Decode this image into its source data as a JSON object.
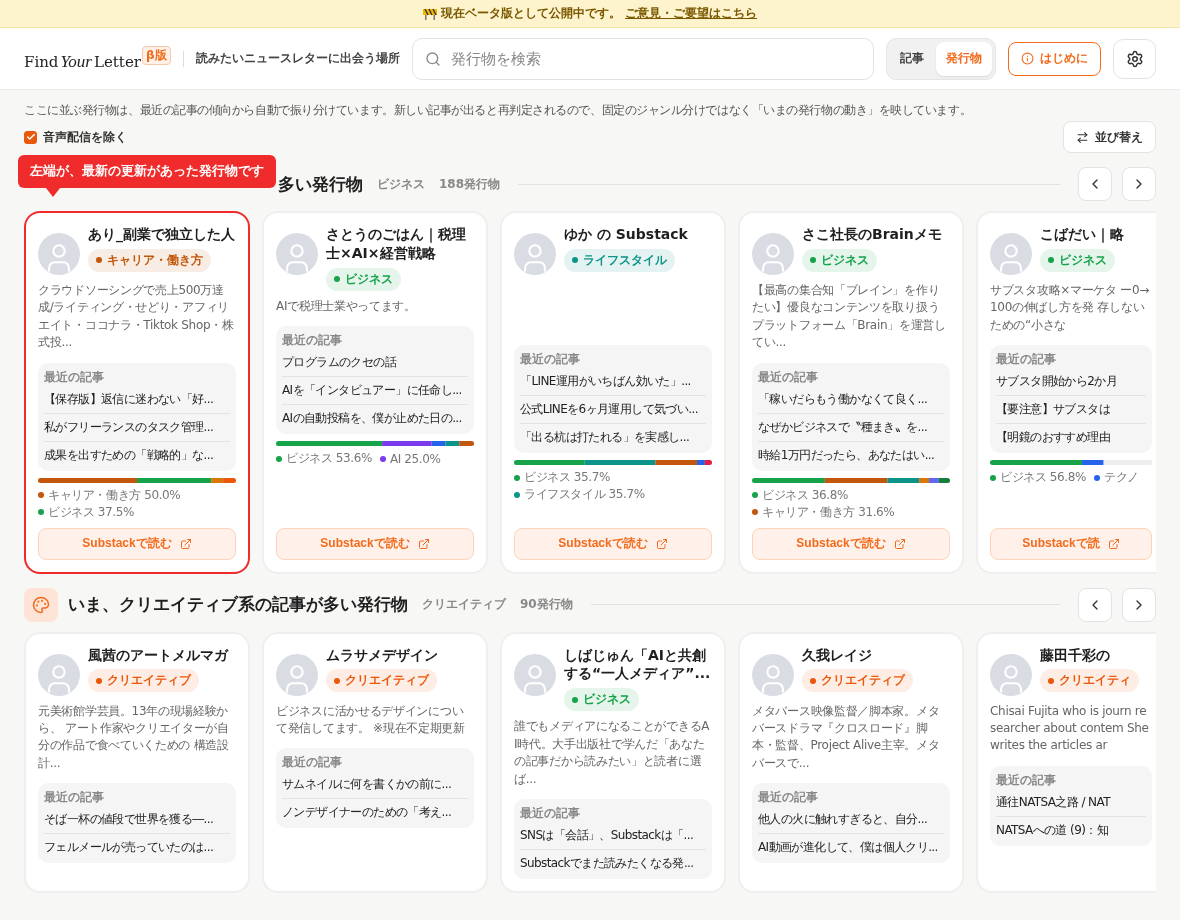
{
  "banner": {
    "text": "現在ベータ版として公開中です。",
    "link": "ご意見・ご要望はこちら"
  },
  "header": {
    "logo": {
      "first": "Find",
      "script": "Your",
      "last": "Letter",
      "badge": "β版"
    },
    "tagline": "読みたいニュースレターに出会う場所",
    "search": {
      "placeholder": "発行物を検索"
    },
    "tabs": [
      {
        "label": "記事",
        "selected": false
      },
      {
        "label": "発行物",
        "selected": true
      }
    ],
    "start_button": "はじめに"
  },
  "intro": "ここに並ぶ発行物は、最近の記事の傾向から自動で振り分けています。新しい記事が出ると再判定されるので、固定のジャンル分けではなく「いまの発行物の動き」を映しています。",
  "filter": {
    "label": "音声配信を除く",
    "checked": true
  },
  "sort_button": "並び替え",
  "sections": [
    {
      "tooltip": "左端が、最新の更新があった発行物です",
      "title": "多い発行物",
      "genre": "ビジネス",
      "count": "188発行物",
      "cards": [
        {
          "selected": true,
          "name": "あり_副業で独立した人",
          "tag": {
            "label": "キャリア・働き方",
            "color": "#c2570c"
          },
          "description": "クラウドソーシングで売上500万達成/ライティング・せどり・アフィリエイト・ココナラ・Tiktok Shop・株式投...",
          "articles_label": "最近の記事",
          "articles": [
            "【保存版】返信に迷わない「好...",
            "私がフリーランスのタスク管理...",
            "成果を出すための「戦略的」な..."
          ],
          "share_bar": true,
          "legend": [
            {
              "label": "キャリア・働き方",
              "value": "50.0%",
              "color": "#c2570c"
            },
            {
              "label": "ビジネス",
              "value": "37.5%",
              "color": "#16a34a"
            }
          ],
          "button": "Substackで読む"
        },
        {
          "selected": false,
          "name": "さとうのごはん｜税理士×AI×経営戦略",
          "tag": {
            "label": "ビジネス",
            "color": "#16a34a"
          },
          "description": "AIで税理士業やってます。",
          "articles_label": "最近の記事",
          "articles": [
            "プログラムのクセの話",
            "AIを「インタビュアー」に任命し...",
            "AIの自動投稿を、僕が止めた日の..."
          ],
          "share_bar": true,
          "legend": [
            {
              "label": "ビジネス",
              "value": "53.6%",
              "color": "#16a34a"
            },
            {
              "label": "AI",
              "value": "25.0%",
              "color": "#7c3aed"
            }
          ],
          "button": "Substackで読む"
        },
        {
          "selected": false,
          "name": "ゆか の Substack",
          "tag": {
            "label": "ライフスタイル",
            "color": "#0d9488"
          },
          "articles_label": "最近の記事",
          "articles": [
            "「LINE運用がいちばん効いた」...",
            "公式LINEを6ヶ月運用して気づい...",
            "「出る杭は打たれる」を実感し..."
          ],
          "share_bar": true,
          "legend": [
            {
              "label": "ビジネス",
              "value": "35.7%",
              "color": "#16a34a"
            },
            {
              "label": "ライフスタイル",
              "value": "35.7%",
              "color": "#0d9488"
            }
          ],
          "button": "Substackで読む"
        },
        {
          "selected": false,
          "name": "さこ社長のBrainメモ",
          "tag": {
            "label": "ビジネス",
            "color": "#16a34a"
          },
          "description": "【最高の集合知「ブレイン」を作りたい】優良なコンテンツを取り扱うプラットフォーム「Brain」を運営してい...",
          "articles_label": "最近の記事",
          "articles": [
            "「稼いだらもう働かなくて良く...",
            "なぜかビジネスで〝種まき〟を...",
            "時給1万円だったら、あなたはい..."
          ],
          "share_bar": true,
          "legend": [
            {
              "label": "ビジネス",
              "value": "36.8%",
              "color": "#16a34a"
            },
            {
              "label": "キャリア・働き方",
              "value": "31.6%",
              "color": "#c2570c"
            }
          ],
          "button": "Substackで読む"
        },
        {
          "selected": false,
          "name": "こばだい｜略",
          "tag": {
            "label": "ビジネス",
            "color": "#16a34a"
          },
          "description": "サブスタ攻略×マーケタ ー0→100の伸ばし方を発 存しないための“小さな",
          "articles_label": "最近の記事",
          "articles": [
            "サブスタ開始から2か月",
            "【要注意】サブスタは",
            "【明鏡のおすすめ理由"
          ],
          "share_bar": true,
          "legend": [
            {
              "label": "ビジネス",
              "value": "56.8%",
              "color": "#16a34a"
            },
            {
              "label": "テクノ",
              "color": "#2563eb"
            }
          ],
          "button": "Substackで読"
        }
      ]
    },
    {
      "kind": "creative",
      "title": "いま、クリエイティブ系の記事が多い発行物",
      "genre": "クリエイティブ",
      "count": "90発行物",
      "cards": [
        {
          "selected": false,
          "name": "風茜のアートメルマガ",
          "tag": {
            "label": "クリエイティブ",
            "color": "#ea580c"
          },
          "description": "元美術館学芸員。13年の現場経験から、 アート作家やクリエイターが自分の作品で食べていくための 構造設計...",
          "articles_label": "最近の記事",
          "articles": [
            "そば一杯の値段で世界を獲る―...",
            "フェルメールが売っていたのは..."
          ]
        },
        {
          "selected": false,
          "name": "ムラサメデザイン",
          "tag": {
            "label": "クリエイティブ",
            "color": "#ea580c"
          },
          "description": "ビジネスに活かせるデザインについて発信してます。 ※現在不定期更新",
          "articles_label": "最近の記事",
          "articles": [
            "サムネイルに何を書くかの前に...",
            "ノンデザイナーのための「考え..."
          ]
        },
        {
          "selected": false,
          "name": "しばじゅん「AIと共創する“一人メディア”...",
          "tag": {
            "label": "ビジネス",
            "color": "#16a34a"
          },
          "description": "誰でもメディアになることができるAI時代。大手出版社で学んだ「あなたの記事だから読みたい」と読者に選ば...",
          "articles_label": "最近の記事",
          "articles": [
            "SNSは「会話」、Substackは「...",
            "Substackでまた読みたくなる発..."
          ]
        },
        {
          "selected": false,
          "name": "久我レイジ",
          "tag": {
            "label": "クリエイティブ",
            "color": "#ea580c"
          },
          "description": "メタバース映像監督／脚本家。メタバースドラマ『クロスロード』脚本・監督、Project Alive主宰。メタバースで...",
          "articles_label": "最近の記事",
          "articles": [
            "他人の火に触れすぎると、自分...",
            "AI動画が進化して、僕は個人クリ..."
          ]
        },
        {
          "selected": false,
          "name": "藤田千彩の",
          "tag": {
            "label": "クリエイティ",
            "color": "#ea580c"
          },
          "description": "Chisai Fujita who is journ researcher about contem She writes the articles ar",
          "articles_label": "最近の記事",
          "articles": [
            "通往NATSA之路 / NAT",
            "NATSAへの道 (9)：知"
          ]
        }
      ]
    }
  ]
}
